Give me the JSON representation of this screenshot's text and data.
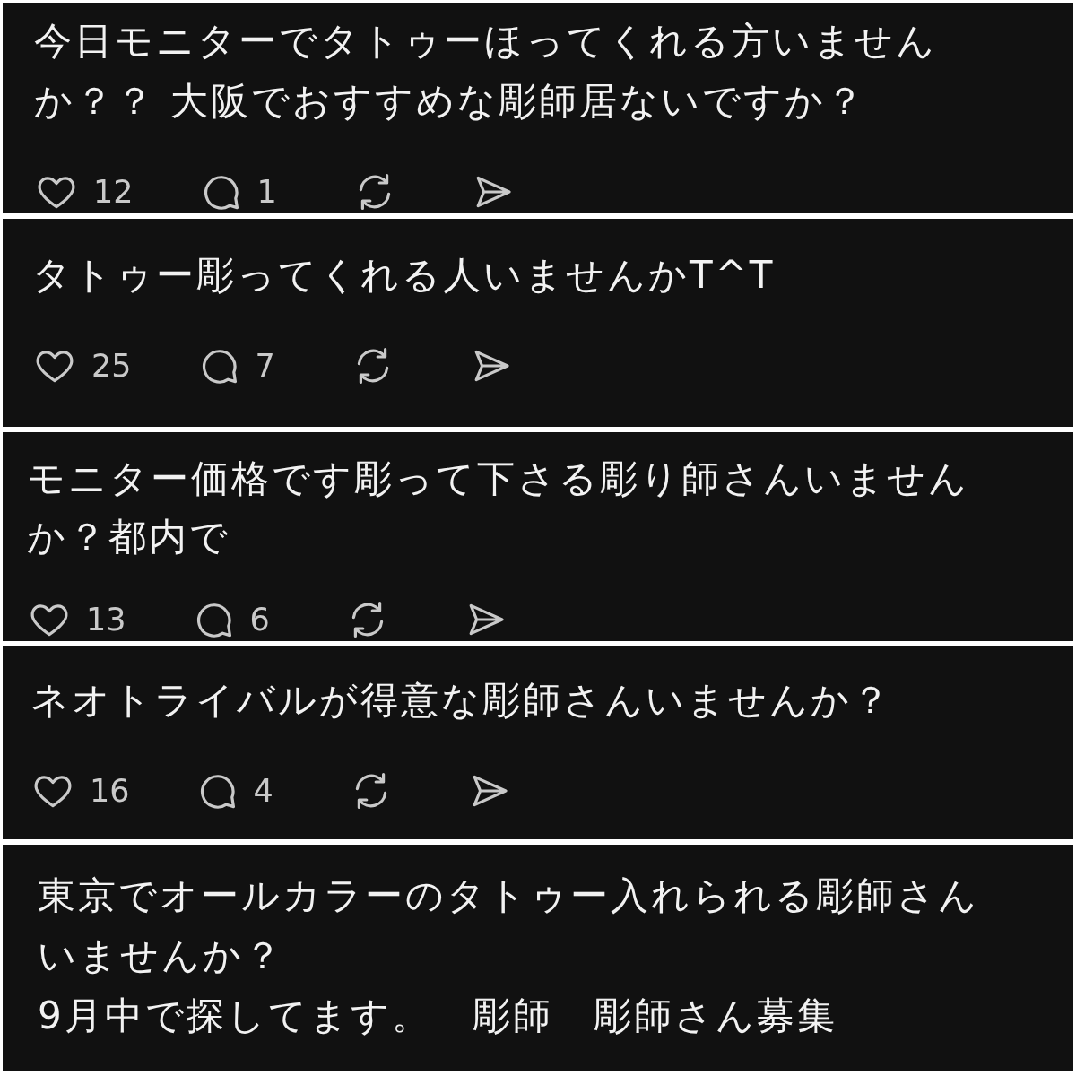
{
  "posts": [
    {
      "text": "今日モニターでタトゥーほってくれる方いませんか？？ 大阪でおすすめな彫師居ないですか？",
      "actions": {
        "likes": "12",
        "comments": "1"
      }
    },
    {
      "text": "タトゥー彫ってくれる人いませんかT^T",
      "actions": {
        "likes": "25",
        "comments": "7"
      }
    },
    {
      "text": "モニター価格です彫って下さる彫り師さんいませんか？都内で",
      "actions": {
        "likes": "13",
        "comments": "6"
      }
    },
    {
      "text": "ネオトライバルが得意な彫師さんいませんか？",
      "actions": {
        "likes": "16",
        "comments": "4"
      }
    },
    {
      "text": "東京でオールカラーのタトゥー入れられる彫師さんいませんか？\n9月中で探してます。　彫師　彫師さん募集"
    }
  ]
}
